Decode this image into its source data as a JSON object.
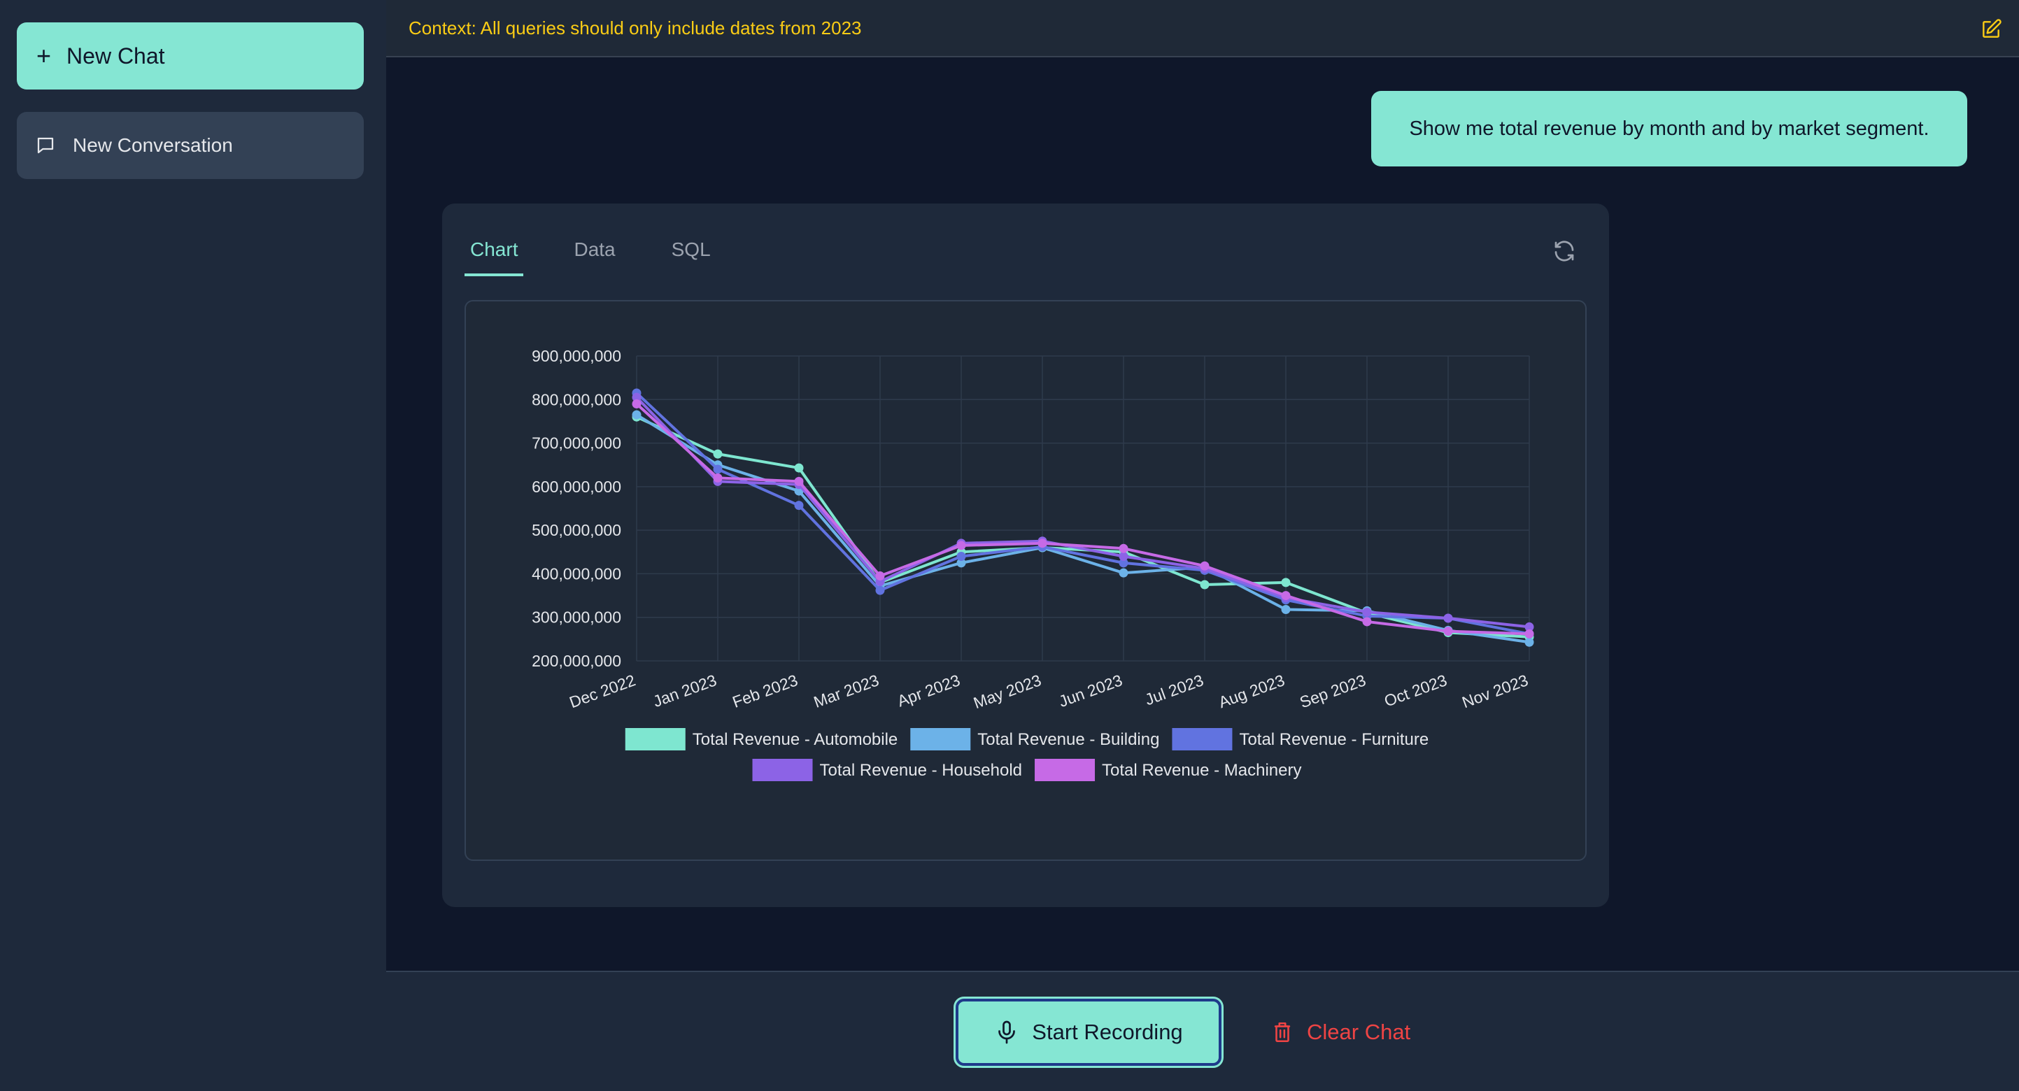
{
  "sidebar": {
    "new_chat_label": "New Chat",
    "conversations": [
      {
        "label": "New Conversation"
      }
    ]
  },
  "context": {
    "text": "Context: All queries should only include dates from 2023"
  },
  "messages": {
    "user": "Show me total revenue by month and by market segment."
  },
  "response": {
    "tabs": [
      {
        "label": "Chart",
        "active": true
      },
      {
        "label": "Data",
        "active": false
      },
      {
        "label": "SQL",
        "active": false
      }
    ]
  },
  "footer": {
    "record_label": "Start Recording",
    "clear_label": "Clear Chat"
  },
  "icons": {
    "new_chat": "plus-icon",
    "conversation": "chat-bubble-icon",
    "context_edit": "edit-icon",
    "refresh": "refresh-icon",
    "record": "microphone-icon",
    "clear": "trash-icon"
  },
  "colors": {
    "accent": "#85e6d3",
    "context_text": "#facc15",
    "danger": "#ef4444"
  },
  "chart_data": {
    "type": "line",
    "title": "",
    "xlabel": "",
    "ylabel": "",
    "x": [
      "Dec 2022",
      "Jan 2023",
      "Feb 2023",
      "Mar 2023",
      "Apr 2023",
      "May 2023",
      "Jun 2023",
      "Jul 2023",
      "Aug 2023",
      "Sep 2023",
      "Oct 2023",
      "Nov 2023"
    ],
    "ylim": [
      200000000,
      900000000
    ],
    "yticks": [
      "200,000,000",
      "300,000,000",
      "400,000,000",
      "500,000,000",
      "600,000,000",
      "700,000,000",
      "800,000,000",
      "900,000,000"
    ],
    "ytick_values": [
      200000000,
      300000000,
      400000000,
      500000000,
      600000000,
      700000000,
      800000000,
      900000000
    ],
    "grid": true,
    "legend_position": "bottom",
    "series": [
      {
        "name": "Total Revenue - Automobile",
        "color": "#7ee6d0",
        "values": [
          760000000,
          675000000,
          643000000,
          380000000,
          450000000,
          460000000,
          450000000,
          375000000,
          380000000,
          310000000,
          265000000,
          255000000
        ]
      },
      {
        "name": "Total Revenue - Building",
        "color": "#6cb2e8",
        "values": [
          765000000,
          650000000,
          590000000,
          372000000,
          425000000,
          460000000,
          402000000,
          415000000,
          318000000,
          315000000,
          270000000,
          243000000
        ]
      },
      {
        "name": "Total Revenue - Furniture",
        "color": "#6173e0",
        "values": [
          815000000,
          640000000,
          557000000,
          362000000,
          440000000,
          462000000,
          425000000,
          408000000,
          340000000,
          303000000,
          298000000,
          262000000
        ]
      },
      {
        "name": "Total Revenue - Household",
        "color": "#8c63e6",
        "values": [
          805000000,
          612000000,
          605000000,
          382000000,
          470000000,
          475000000,
          440000000,
          412000000,
          345000000,
          312000000,
          298000000,
          278000000
        ]
      },
      {
        "name": "Total Revenue - Machinery",
        "color": "#c66ae6",
        "values": [
          790000000,
          620000000,
          612000000,
          395000000,
          465000000,
          470000000,
          458000000,
          418000000,
          350000000,
          290000000,
          268000000,
          262000000
        ]
      }
    ]
  }
}
